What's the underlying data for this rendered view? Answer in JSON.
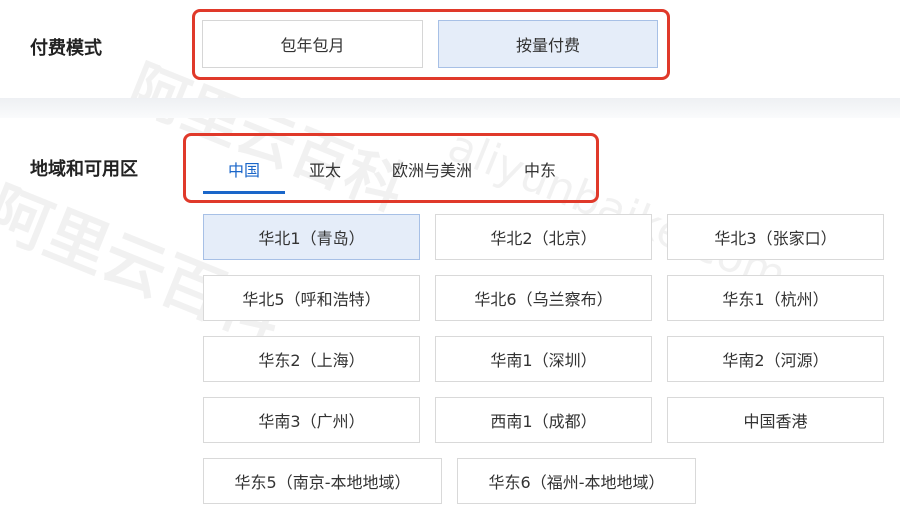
{
  "billing": {
    "label": "付费模式",
    "options": [
      "包年包月",
      "按量付费"
    ],
    "selected": "按量付费"
  },
  "region": {
    "label": "地域和可用区",
    "tabs": [
      "中国",
      "亚太",
      "欧洲与美洲",
      "中东"
    ],
    "active_tab": "中国",
    "items": [
      "华北1（青岛）",
      "华北2（北京）",
      "华北3（张家口）",
      "华北5（呼和浩特）",
      "华北6（乌兰察布）",
      "华东1（杭州）",
      "华东2（上海）",
      "华南1（深圳）",
      "华南2（河源）",
      "华南3（广州）",
      "西南1（成都）",
      "中国香港",
      "华东5（南京-本地地域）",
      "华东6（福州-本地地域）"
    ],
    "selected": "华北1（青岛）"
  },
  "watermark": {
    "text_cn": "阿里云百科",
    "text_en": "aliyunbaike.com"
  },
  "colors": {
    "accent": "#1a66c9",
    "highlight_border": "#e0392a",
    "selected_bg": "#e5edf9"
  }
}
